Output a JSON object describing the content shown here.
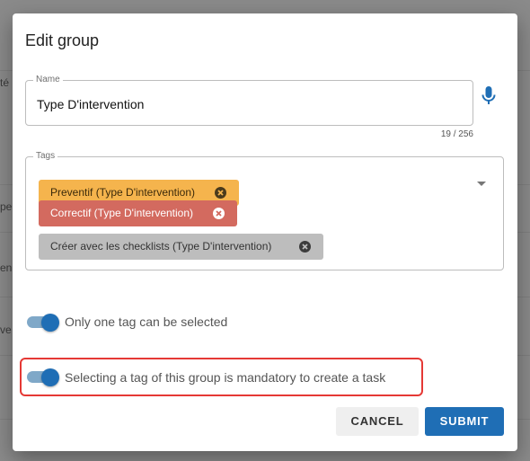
{
  "background": {
    "fragments": [
      "té",
      "pe",
      "en",
      "ve"
    ]
  },
  "dialog": {
    "title": "Edit group",
    "name_field": {
      "label": "Name",
      "value": "Type D'intervention",
      "counter": "19 / 256"
    },
    "tags_field": {
      "label": "Tags",
      "chips": [
        {
          "label": "Preventif (Type D'intervention)",
          "color": "#f5b44d"
        },
        {
          "label": "Correctif (Type D'intervention)",
          "color": "#d36a5f"
        },
        {
          "label": "Créer avec les checklists (Type D'intervention)",
          "color": "#bdbdbd"
        }
      ]
    },
    "toggles": [
      {
        "label": "Only one tag can be selected",
        "on": true
      },
      {
        "label": "Selecting a tag of this group is mandatory to create a task",
        "on": true
      }
    ],
    "buttons": {
      "cancel": "CANCEL",
      "submit": "SUBMIT"
    },
    "colors": {
      "primary": "#1f6eb5",
      "highlight": "#e53935"
    },
    "icons": {
      "mic": "microphone-icon",
      "dropdown": "dropdown-arrow-icon",
      "chip_close": "close-circle-icon"
    }
  }
}
